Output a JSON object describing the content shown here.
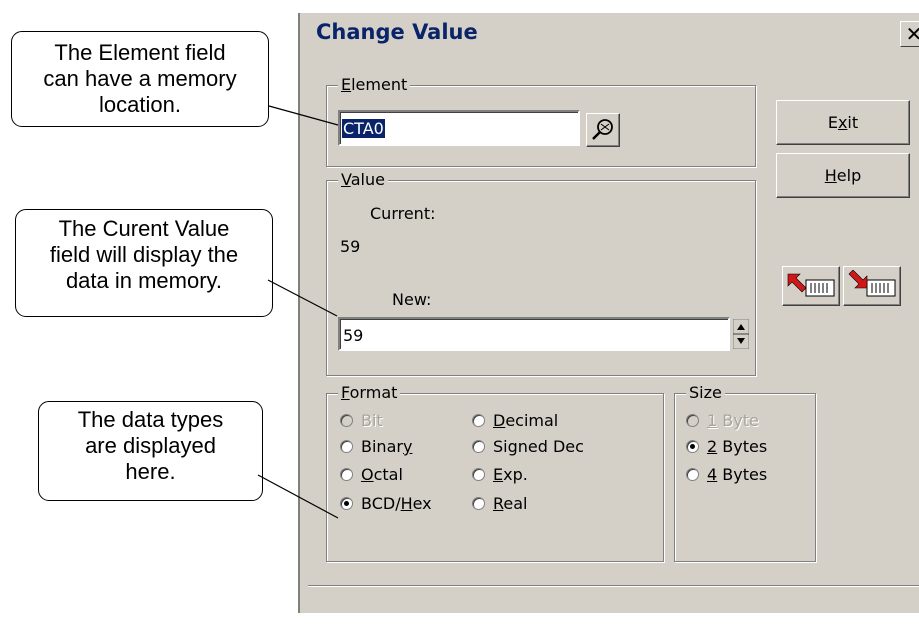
{
  "callouts": {
    "element": {
      "line1": "The Element field",
      "line2": "can have a memory",
      "line3": "location."
    },
    "value": {
      "line1": "The Curent Value",
      "line2": "field will display the",
      "line3": "data in memory."
    },
    "format": {
      "line1": "The data types",
      "line2": "are displayed",
      "line3": "here."
    }
  },
  "dialog": {
    "title": "Change Value",
    "close_glyph": "✕",
    "element_group": {
      "label_u": "E",
      "label_rest": "lement",
      "value": "CTA0",
      "browse_icon": "search-icon"
    },
    "value_group": {
      "label_u": "V",
      "label_rest": "alue",
      "current_label": "Current:",
      "current_value": "59",
      "new_label": "New:",
      "new_value": "59"
    },
    "buttons": {
      "exit": {
        "pre": "E",
        "u": "x",
        "post": "it"
      },
      "help": {
        "u": "H",
        "post": "elp"
      }
    },
    "format_group": {
      "label_u": "F",
      "label_rest": "ormat",
      "options": [
        {
          "pre": "",
          "u": "",
          "post": "Bit",
          "selected": false,
          "disabled": true
        },
        {
          "pre": "",
          "u": "D",
          "post": "ecimal",
          "selected": false,
          "disabled": false
        },
        {
          "pre": "Binar",
          "u": "y",
          "post": "",
          "selected": false,
          "disabled": false
        },
        {
          "pre": "",
          "u": "",
          "post": "Signed Dec",
          "selected": false,
          "disabled": false
        },
        {
          "pre": "",
          "u": "O",
          "post": "ctal",
          "selected": false,
          "disabled": false
        },
        {
          "pre": "",
          "u": "E",
          "post": "xp.",
          "selected": false,
          "disabled": false
        },
        {
          "pre": "BCD/",
          "u": "H",
          "post": "ex",
          "selected": true,
          "disabled": false
        },
        {
          "pre": "",
          "u": "R",
          "post": "eal",
          "selected": false,
          "disabled": false
        }
      ]
    },
    "size_group": {
      "label": "Size",
      "options": [
        {
          "u": "1",
          "post": " Byte",
          "selected": false,
          "disabled": true
        },
        {
          "u": "2",
          "post": " Bytes",
          "selected": true,
          "disabled": false
        },
        {
          "u": "4",
          "post": " Bytes",
          "selected": false,
          "disabled": false
        }
      ]
    },
    "colors": {
      "face": "#d4d0c8",
      "title_text": "#0a246a",
      "highlight": "#0a246a",
      "arrow_red": "#d01818"
    }
  }
}
